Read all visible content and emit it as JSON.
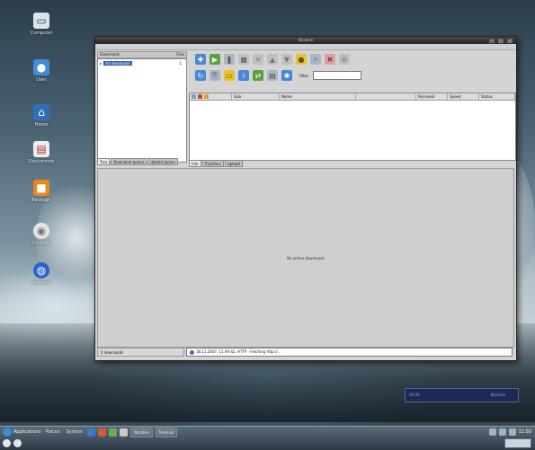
{
  "window": {
    "title": "Nicotine",
    "filter_label": "Filter:",
    "filter_value": ""
  },
  "left_panel": {
    "header_left": "Downloads",
    "header_right": "Files",
    "items": [
      {
        "label": "All downloads",
        "count": "1"
      }
    ],
    "tabs": [
      {
        "label": "Tree",
        "active": true
      },
      {
        "label": "Download queue"
      },
      {
        "label": "Upload queue"
      }
    ]
  },
  "list": {
    "columns": [
      "Size",
      "Name",
      "Received",
      "Speed",
      "Status"
    ]
  },
  "right_tabs": [
    {
      "label": "Info",
      "active": true
    },
    {
      "label": "Transfers"
    },
    {
      "label": "Upload"
    }
  ],
  "log": {
    "empty_message": "No active downloads"
  },
  "statusbar": {
    "left": "0 downloads",
    "log_line": "18.11.2007, 11:49:42, HTTP - Fetching http://..."
  },
  "notify": {
    "left": "00:00",
    "right": "Nicotine"
  },
  "taskbar": {
    "start_label": "Applications",
    "menu": [
      "Places",
      "System"
    ],
    "tasks": [
      "Nicotine",
      "Terminal"
    ],
    "clock": "11:50"
  },
  "desktop_icons": [
    {
      "label": "Computer",
      "icon": "computer-icon"
    },
    {
      "label": "User",
      "icon": "user-icon"
    },
    {
      "label": "Home",
      "icon": "home-icon"
    },
    {
      "label": "Documents",
      "icon": "document-icon"
    },
    {
      "label": "Package",
      "icon": "package-icon"
    },
    {
      "label": "CD-ROM",
      "icon": "cd-icon"
    },
    {
      "label": "Internet",
      "icon": "globe-icon"
    }
  ],
  "colors": {
    "selection": "#2c5fb0",
    "titlebar": "#262626",
    "notify_bg": "#1c2a55"
  }
}
